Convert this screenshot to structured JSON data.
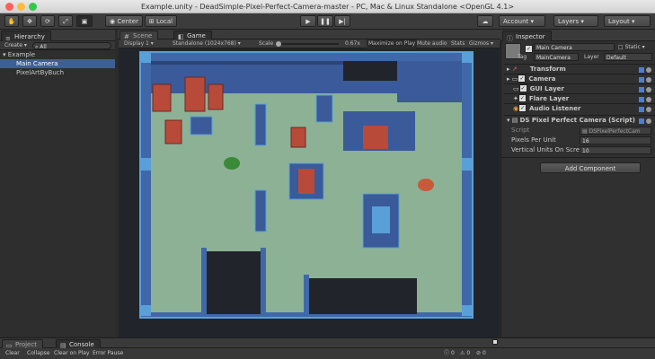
{
  "window": {
    "title": "Example.unity - DeadSimple-Pixel-Perfect-Camera-master - PC, Mac & Linux Standalone <OpenGL 4.1>"
  },
  "toolbar": {
    "center_label": "Center",
    "local_label": "Local",
    "account_label": "Account",
    "layers_label": "Layers",
    "layout_label": "Layout"
  },
  "hierarchy": {
    "tab_label": "Hierarchy",
    "create_label": "Create",
    "search_placeholder": "All",
    "scene_name": "Example",
    "items": [
      "Main Camera",
      "PixelArtByBuch"
    ]
  },
  "tabs": {
    "scene": "Scene",
    "game": "Game"
  },
  "gamebar": {
    "display": "Display 1",
    "resolution": "Standalone (1024x768)",
    "scale_label": "Scale",
    "scale_value": "0.67x",
    "maximize": "Maximize on Play",
    "mute": "Mute audio",
    "stats": "Stats",
    "gizmos": "Gizmos"
  },
  "inspector": {
    "tab_label": "Inspector",
    "object_name": "Main Camera",
    "static_label": "Static",
    "tag_label": "Tag",
    "tag_value": "MainCamera",
    "layer_label": "Layer",
    "layer_value": "Default",
    "components": [
      "Transform",
      "Camera",
      "GUI Layer",
      "Flare Layer",
      "Audio Listener",
      "DS Pixel Perfect Camera (Script)"
    ],
    "script_label": "Script",
    "script_value": "DSPixelPerfectCam",
    "ppu_label": "Pixels Per Unit",
    "ppu_value": "16",
    "vu_label": "Vertical Units On Scre",
    "vu_value": "10",
    "add_component": "Add Component"
  },
  "bottom": {
    "project_tab": "Project",
    "console_tab": "Console",
    "clear": "Clear",
    "collapse": "Collapse",
    "clear_on_play": "Clear on Play",
    "error_pause": "Error Pause",
    "count_log": "0",
    "count_warn": "0",
    "count_err": "0"
  },
  "colors": {
    "floor": "#8db195",
    "wall": "#3a5a9a",
    "wall_cap": "#4a8cc8",
    "dark": "#1f2030",
    "door": "#b84a3a"
  }
}
